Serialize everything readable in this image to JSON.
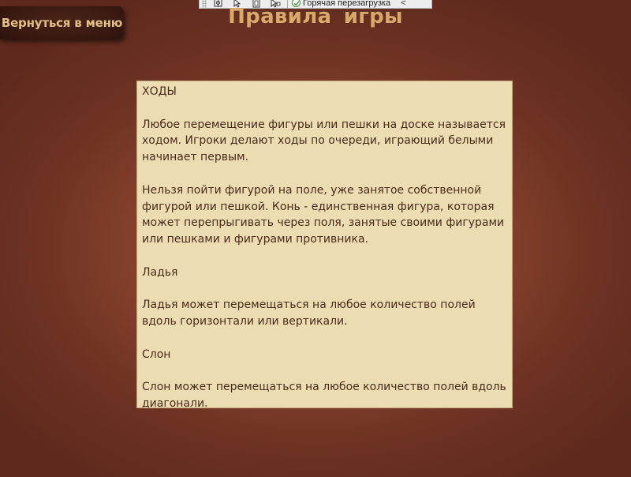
{
  "devbar": {
    "icons": [
      "grip-icon",
      "select-element-icon",
      "pointer-select-icon",
      "layout-adorner-icon",
      "track-focus-icon",
      "hot-reload-check-icon"
    ],
    "hot_reload_label": "Горячая перезагрузка",
    "collapse_glyph": "<"
  },
  "back_button": {
    "label": "Вернуться в меню"
  },
  "page": {
    "title": "Правила  игры"
  },
  "rules": {
    "paragraphs": [
      "ХОДЫ",
      "",
      "Любое перемещение фигуры или пешки на доске называется ходом. Игроки делают ходы по очереди, играющий белыми начинает первым.",
      "",
      "Нельзя пойти фигурой на поле, уже занятое собственной фигурой или пешкой. Конь - единственная фигура, которая может перепрыгивать через поля, занятые своими фигурами или пешками и фигурами противника.",
      "",
      "Ладья",
      "",
      "Ладья может перемещаться на любое количество полей вдоль горизонтали или вертикали.",
      "",
      "Слон",
      "",
      "Слон может перемещаться на любое количество полей вдоль диагонали."
    ]
  },
  "colors": {
    "background": "#8c4530",
    "button_bg": "#3a1a12",
    "button_text": "#e3bf86",
    "title": "#d7a96b",
    "panel_bg": "#ecdcb2",
    "panel_text": "#4a2a1a"
  }
}
